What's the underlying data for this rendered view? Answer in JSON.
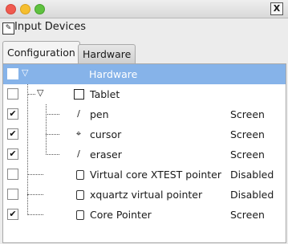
{
  "app": {
    "title": "Input Devices"
  },
  "tabs": [
    {
      "label": "Configuration",
      "active": true
    },
    {
      "label": "Hardware",
      "active": false
    }
  ],
  "tree": {
    "root": {
      "label": "Hardware",
      "checked": false,
      "expanded": true
    },
    "tablet": {
      "label": "Tablet",
      "checked": false,
      "expanded": true
    },
    "rows": [
      {
        "label": "pen",
        "mode": "Screen",
        "checked": true,
        "icon": "pen-icon"
      },
      {
        "label": "cursor",
        "mode": "Screen",
        "checked": true,
        "icon": "cursor-icon"
      },
      {
        "label": "eraser",
        "mode": "Screen",
        "checked": true,
        "icon": "eraser-icon"
      },
      {
        "label": "Virtual core XTEST pointer",
        "mode": "Disabled",
        "checked": false,
        "icon": "mouse-icon"
      },
      {
        "label": "xquartz virtual pointer",
        "mode": "Disabled",
        "checked": false,
        "icon": "mouse-icon"
      },
      {
        "label": "Core Pointer",
        "mode": "Screen",
        "checked": true,
        "icon": "mouse-icon"
      }
    ]
  },
  "colors": {
    "selection": "#86b3e9",
    "close": "#f05a4f",
    "minimize": "#f5be2f",
    "maximize": "#5fc13f"
  }
}
